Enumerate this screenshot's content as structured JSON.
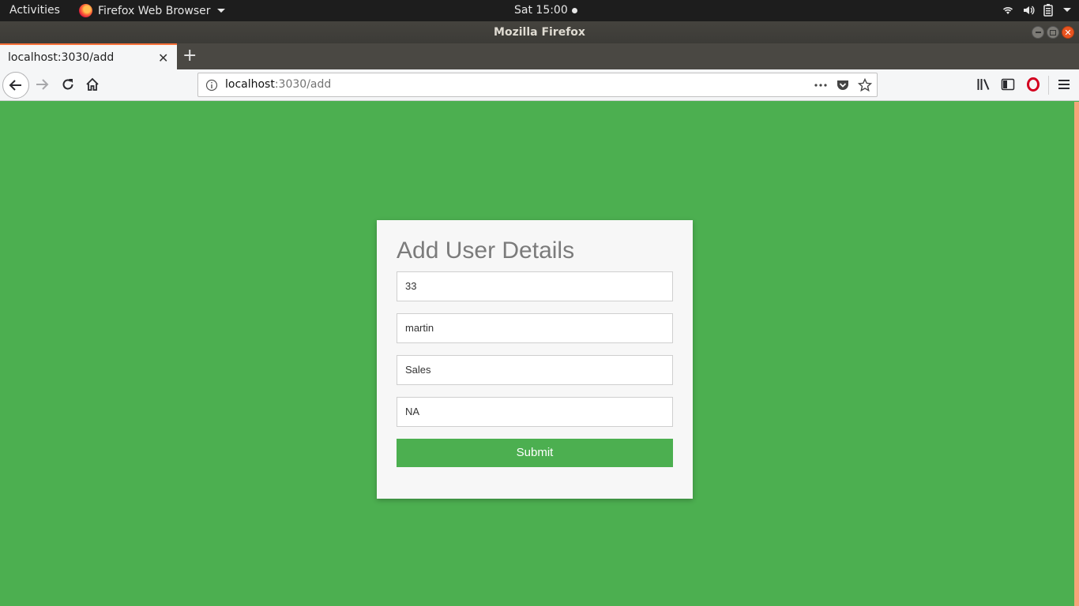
{
  "system": {
    "activities": "Activities",
    "app_menu": "Firefox Web Browser",
    "clock": "Sat 15:00"
  },
  "window": {
    "title": "Mozilla Firefox"
  },
  "tabs": [
    {
      "title": "localhost:3030/add",
      "active": true
    }
  ],
  "urlbar": {
    "host": "localhost",
    "rest": ":3030/add"
  },
  "form": {
    "title": "Add User Details",
    "fields": [
      {
        "value": "33"
      },
      {
        "value": "martin"
      },
      {
        "value": "Sales"
      },
      {
        "value": "NA"
      }
    ],
    "submit_label": "Submit"
  },
  "colors": {
    "page_background": "#4caf50",
    "submit_button": "#4caf50",
    "tab_accent": "#ff7139"
  }
}
